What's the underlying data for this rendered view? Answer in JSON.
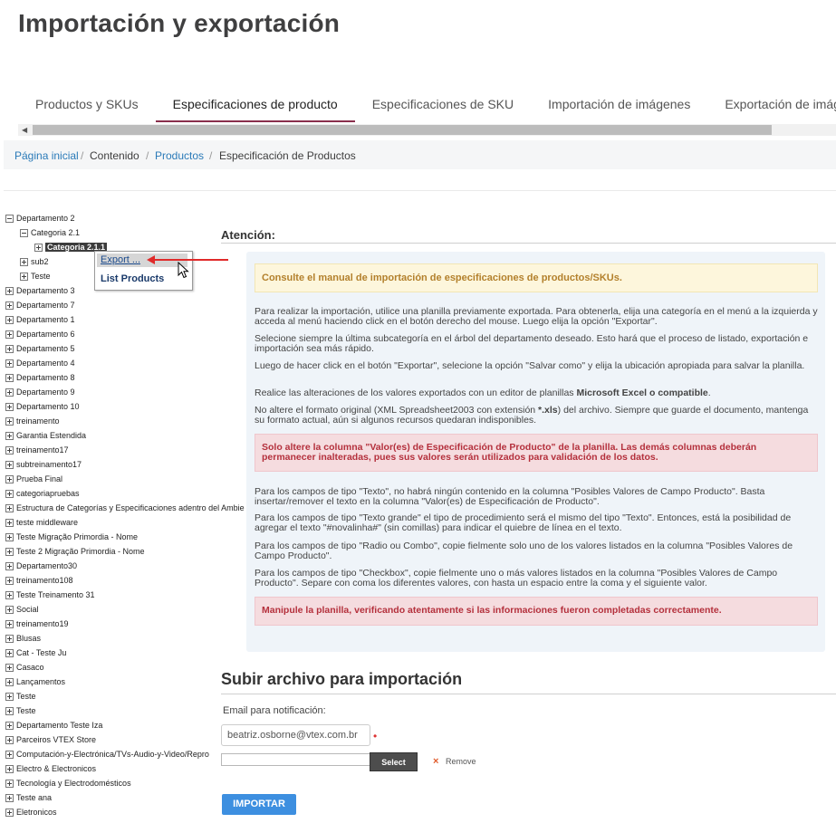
{
  "page_title": "Importación y exportación",
  "tabs": [
    {
      "label": "Productos y SKUs"
    },
    {
      "label": "Especificaciones de producto"
    },
    {
      "label": "Especificaciones de SKU"
    },
    {
      "label": "Importación de imágenes"
    },
    {
      "label": "Exportación de imágenes"
    }
  ],
  "breadcrumb": {
    "home": "Página inicial",
    "content": "Contenido",
    "products": "Productos",
    "current": "Especificación de Productos",
    "separator": "/"
  },
  "tree": {
    "nodes": [
      {
        "label": "Departamento 2",
        "toggle": "minus"
      },
      {
        "label": "Categoria 2.1",
        "toggle": "minus"
      },
      {
        "label": "Categoria 2.1.1",
        "toggle": "plus"
      },
      {
        "label": "sub2",
        "toggle": "plus"
      },
      {
        "label": "Teste",
        "toggle": "plus"
      },
      {
        "label": "Departamento 3",
        "toggle": "plus"
      },
      {
        "label": "Departamento 7",
        "toggle": "plus"
      },
      {
        "label": "Departamento 1",
        "toggle": "plus"
      },
      {
        "label": "Departamento 6",
        "toggle": "plus"
      },
      {
        "label": "Departamento 5",
        "toggle": "plus"
      },
      {
        "label": "Departamento 4",
        "toggle": "plus"
      },
      {
        "label": "Departamento 8",
        "toggle": "plus"
      },
      {
        "label": "Departamento 9",
        "toggle": "plus"
      },
      {
        "label": "Departamento 10",
        "toggle": "plus"
      },
      {
        "label": "treinamento",
        "toggle": "plus"
      },
      {
        "label": "Garantia Estendida",
        "toggle": "plus"
      },
      {
        "label": "treinamento17",
        "toggle": "plus"
      },
      {
        "label": "subtreinamento17",
        "toggle": "plus"
      },
      {
        "label": "Prueba Final",
        "toggle": "plus"
      },
      {
        "label": "categoriapruebas",
        "toggle": "plus"
      },
      {
        "label": "Estructura de Categorías y Especificaciones adentro del Ambie",
        "toggle": "plus"
      },
      {
        "label": "teste middleware",
        "toggle": "plus"
      },
      {
        "label": "Teste Migração Primordia - Nome",
        "toggle": "plus"
      },
      {
        "label": "Teste 2 Migração Primordia - Nome",
        "toggle": "plus"
      },
      {
        "label": "Departamento30",
        "toggle": "plus"
      },
      {
        "label": "treinamento108",
        "toggle": "plus"
      },
      {
        "label": "Teste Treinamento 31",
        "toggle": "plus"
      },
      {
        "label": "Social",
        "toggle": "plus"
      },
      {
        "label": "treinamento19",
        "toggle": "plus"
      },
      {
        "label": "Blusas",
        "toggle": "plus"
      },
      {
        "label": "Cat - Teste Ju",
        "toggle": "plus"
      },
      {
        "label": "Casaco",
        "toggle": "plus"
      },
      {
        "label": "Lançamentos",
        "toggle": "plus"
      },
      {
        "label": "Teste",
        "toggle": "plus"
      },
      {
        "label": "Teste",
        "toggle": "plus"
      },
      {
        "label": "Departamento Teste Iza",
        "toggle": "plus"
      },
      {
        "label": "Parceiros VTEX Store",
        "toggle": "plus"
      },
      {
        "label": "Computación-y-Electrónica/TVs-Audio-y-Video/Repro",
        "toggle": "plus"
      },
      {
        "label": "Electro & Electronicos",
        "toggle": "plus"
      },
      {
        "label": "Tecnología y Electrodomésticos",
        "toggle": "plus"
      },
      {
        "label": "Teste ana",
        "toggle": "plus"
      },
      {
        "label": "Eletronicos",
        "toggle": "plus"
      }
    ]
  },
  "context_menu": {
    "export": "Export ...",
    "list_products": "List Products"
  },
  "attention": {
    "heading": "Atención:",
    "manual_notice": "Consulte el manual de importación de especificaciones de productos/SKUs.",
    "p1": "Para realizar la importación, utilice una planilla previamente exportada. Para obtenerla, elija una categoría en el menú a la izquierda y acceda al menú haciendo click en el botón derecho del mouse. Luego elija la opción \"Exportar\".",
    "p2": "Selecione siempre la última subcategoría en el árbol del departamento deseado. Esto hará que el proceso de listado, exportación e importación sea más rápido.",
    "p3": "Luego de hacer click en el botón \"Exportar\", selecione la opción \"Salvar como\" y elija la ubicación apropiada para salvar la planilla.",
    "p4_prefix": "Realice las alteraciones de los valores exportados con un editor de planillas ",
    "p4_bold": "Microsoft Excel o compatible",
    "p4_suffix": ".",
    "p5_prefix": "No altere el formato original (XML Spreadsheet2003 con extensión ",
    "p5_bold": "*.xls",
    "p5_suffix": ") del archivo. Siempre que guarde el documento, mantenga su formato actual, aún si algunos recursos quedaran indisponibles.",
    "danger1": "Solo altere la columna \"Valor(es) de Especificación de Producto\" de la planilla. Las demás columnas deberán permanecer inalteradas, pues sus valores serán utilizados para validación de los datos.",
    "p6": "Para los campos de tipo \"Texto\", no habrá ningún contenido en la columna \"Posibles Valores de Campo Producto\". Basta insertar/remover el texto en la columna \"Valor(es) de Especificación de Producto\".",
    "p7": "Para los campos de tipo \"Texto grande\" el tipo de procedimiento será el mismo del tipo \"Texto\". Entonces, está la posibilidad de agregar el texto \"#novalinha#\" (sin comillas) para indicar el quiebre de línea en el texto.",
    "p8": "Para los campos de tipo \"Radio ou Combo\", copie fielmente solo uno de los valores listados en la columna \"Posibles Valores de Campo Producto\".",
    "p9": "Para los campos de tipo \"Checkbox\", copie fielmente uno o más valores listados en la columna \"Posibles Valores de Campo Producto\". Separe con coma los diferentes valores, con hasta un espacio entre la coma y el siguiente valor.",
    "danger2": "Manipule la planilla, verificando atentamente si las informaciones fueron completadas correctamente."
  },
  "upload": {
    "heading": "Subir archivo para importación",
    "email_label": "Email para notificación:",
    "email_value": "beatriz.osborne@vtex.com.br",
    "required_mark": "•",
    "select_label": "Select",
    "remove_icon": "×",
    "remove_label": "Remove",
    "import_label": "IMPORTAR"
  },
  "colors": {
    "active_tab": "#8a2e4c",
    "link": "#2a7ab8",
    "primary_button": "#3d8fe0",
    "warning_text": "#b3802c",
    "danger_text": "#b4303c"
  }
}
